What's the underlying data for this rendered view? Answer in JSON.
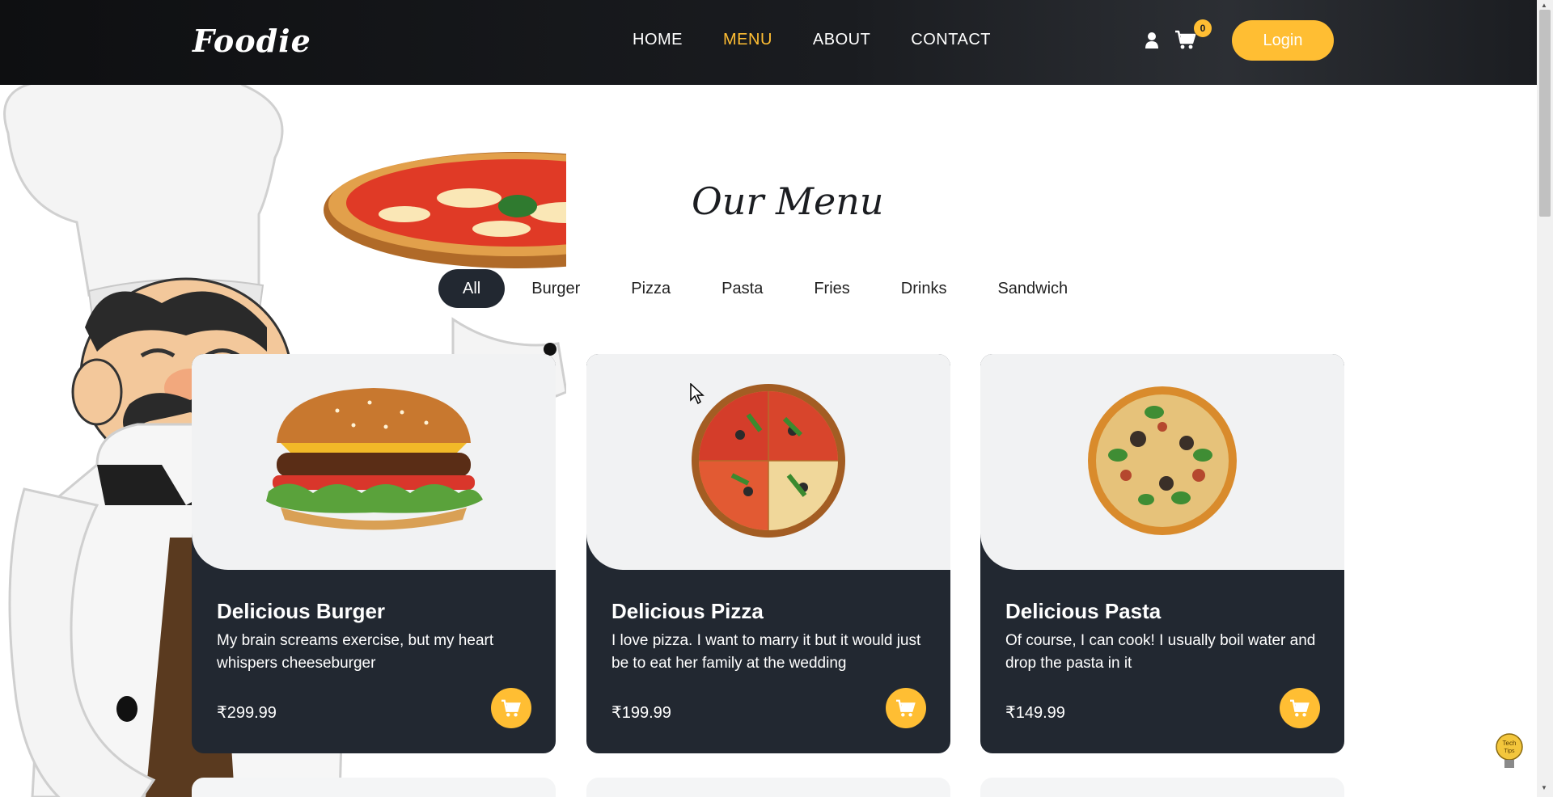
{
  "brand": {
    "logo": "Foodie"
  },
  "nav": {
    "links": [
      {
        "label": "HOME",
        "active": false
      },
      {
        "label": "MENU",
        "active": true
      },
      {
        "label": "ABOUT",
        "active": false
      },
      {
        "label": "CONTACT",
        "active": false
      }
    ],
    "cart_count": "0",
    "login_label": "Login",
    "user_icon": "user-icon",
    "cart_icon": "cart-icon"
  },
  "menu": {
    "title": "Our Menu",
    "filters": [
      "All",
      "Burger",
      "Pizza",
      "Pasta",
      "Fries",
      "Drinks",
      "Sandwich"
    ],
    "active_filter": "All",
    "items": [
      {
        "name": "Delicious Burger",
        "description": "My brain screams exercise, but my heart whispers cheeseburger",
        "price": "₹299.99",
        "image": "burger"
      },
      {
        "name": "Delicious Pizza",
        "description": "I love pizza. I want to marry it but it would just be to eat her family at the wedding",
        "price": "₹199.99",
        "image": "pizza"
      },
      {
        "name": "Delicious Pasta",
        "description": "Of course, I can cook! I usually boil water and drop the pasta in it",
        "price": "₹149.99",
        "image": "pasta-pizza"
      }
    ]
  },
  "colors": {
    "accent": "#ffbe33",
    "dark": "#222831",
    "card_image_bg": "#f1f2f3"
  },
  "watermark": "Tech Tips"
}
